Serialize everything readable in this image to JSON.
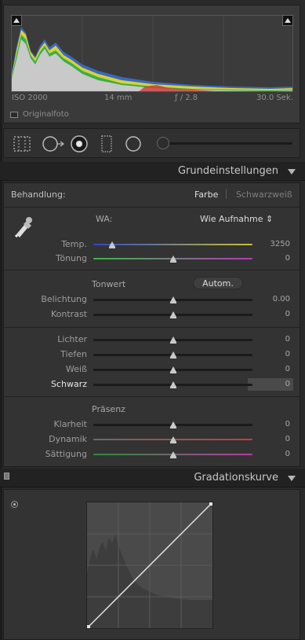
{
  "histogram": {
    "exif": {
      "iso": "ISO 2000",
      "focal": "14 mm",
      "aperture": "ƒ / 2.8",
      "shutter": "30.0 Sek."
    },
    "original_label": "Originalfoto"
  },
  "tools": [
    "crop-overlay-icon",
    "spot-removal-icon",
    "red-eye-icon",
    "graduated-filter-icon",
    "radial-filter-icon",
    "adjustment-brush-icon"
  ],
  "basic": {
    "title": "Grundeinstellungen",
    "treatment_label": "Behandlung:",
    "treatment_color": "Farbe",
    "treatment_bw": "Schwarzweiß",
    "wb_label": "WA:",
    "wb_value": "Wie Aufnahme ⇕",
    "sliders_wb": [
      {
        "label": "Temp.",
        "value": "3250",
        "pos": 0.12
      },
      {
        "label": "Tönung",
        "value": "0",
        "pos": 0.5
      }
    ],
    "tone_label": "Tonwert",
    "auto_label": "Autom.",
    "sliders_tone1": [
      {
        "label": "Belichtung",
        "value": "0.00",
        "pos": 0.5
      },
      {
        "label": "Kontrast",
        "value": "0",
        "pos": 0.5
      }
    ],
    "sliders_tone2": [
      {
        "label": "Lichter",
        "value": "0",
        "pos": 0.5
      },
      {
        "label": "Tiefen",
        "value": "0",
        "pos": 0.5
      },
      {
        "label": "Weiß",
        "value": "0",
        "pos": 0.5
      },
      {
        "label": "Schwarz",
        "value": "0",
        "pos": 0.5
      }
    ],
    "presence_label": "Präsenz",
    "sliders_presence": [
      {
        "label": "Klarheit",
        "value": "0",
        "pos": 0.5
      },
      {
        "label": "Dynamik",
        "value": "0",
        "pos": 0.5
      },
      {
        "label": "Sättigung",
        "value": "0",
        "pos": 0.5
      }
    ]
  },
  "curve": {
    "title": "Gradationskurve"
  },
  "colors": {
    "temp_gradient": [
      "#2f46c6",
      "#c7c23a"
    ],
    "tint_gradient": [
      "#39b84a",
      "#b53ab8"
    ],
    "vibrance_gradient": [
      "#6a6a6a",
      "#c83c3c"
    ],
    "saturation_gradient": [
      "#2b8c3c",
      "#b83ca0"
    ]
  }
}
